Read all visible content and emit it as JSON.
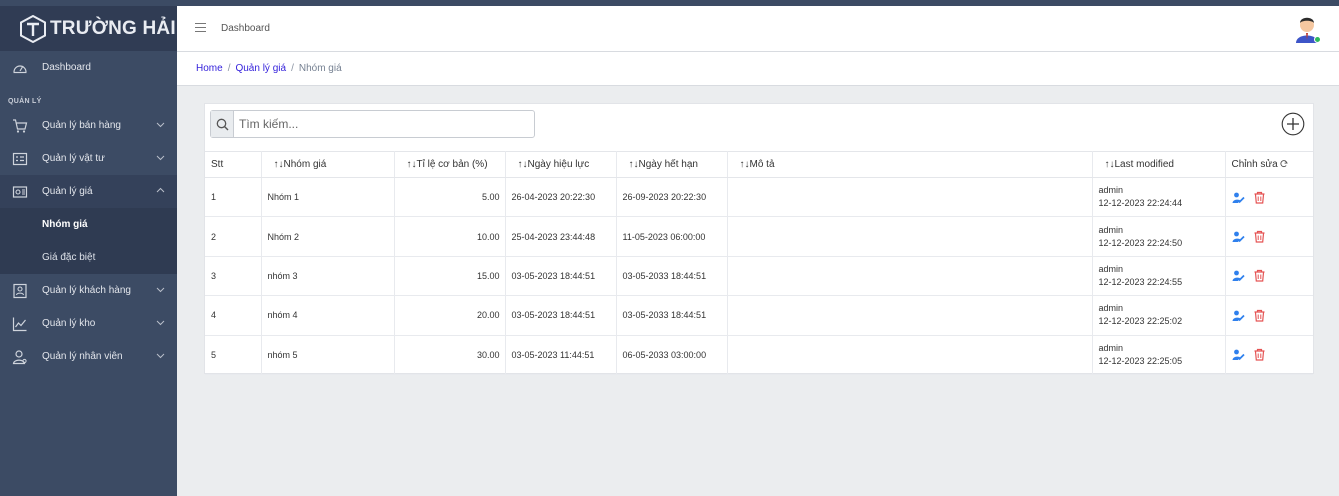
{
  "brand": {
    "name": "TRƯỜNG HẢI"
  },
  "sidebar": {
    "dashboard": "Dashboard",
    "section_title": "QUẢN LÝ",
    "items": [
      {
        "label": "Quản lý bán hàng",
        "icon": "cart-icon"
      },
      {
        "label": "Quản lý vật tư",
        "icon": "list-box-icon"
      },
      {
        "label": "Quản lý giá",
        "icon": "price-tag-icon",
        "expanded": true,
        "children": [
          {
            "label": "Nhóm giá",
            "selected": true
          },
          {
            "label": "Giá đặc biệt"
          }
        ]
      },
      {
        "label": "Quản lý khách hàng",
        "icon": "customer-icon"
      },
      {
        "label": "Quản lý kho",
        "icon": "chart-icon"
      },
      {
        "label": "Quản lý nhân viên",
        "icon": "staff-icon"
      }
    ]
  },
  "header": {
    "link": "Dashboard"
  },
  "breadcrumb": {
    "home": "Home",
    "level1": "Quản lý giá",
    "current": "Nhóm giá"
  },
  "search": {
    "placeholder": "Tìm kiếm...",
    "value": ""
  },
  "table": {
    "columns": [
      "Stt",
      "↑↓Nhóm giá",
      "↑↓Tỉ lệ cơ bản (%)",
      "↑↓Ngày hiệu lực",
      "↑↓Ngày hết hạn",
      "↑↓Mô tả",
      "↑↓Last modified",
      "Chỉnh sửa"
    ],
    "rows": [
      {
        "stt": "1",
        "nhom": "Nhóm 1",
        "tile": "5.00",
        "hieuluc": "26-04-2023 20:22:30",
        "hethan": "26-09-2023 20:22:30",
        "mota": "",
        "user": "admin",
        "modified": "12-12-2023 22:24:44"
      },
      {
        "stt": "2",
        "nhom": "Nhóm 2",
        "tile": "10.00",
        "hieuluc": "25-04-2023 23:44:48",
        "hethan": "11-05-2023 06:00:00",
        "mota": "",
        "user": "admin",
        "modified": "12-12-2023 22:24:50"
      },
      {
        "stt": "3",
        "nhom": "nhóm 3",
        "tile": "15.00",
        "hieuluc": "03-05-2023 18:44:51",
        "hethan": "03-05-2033 18:44:51",
        "mota": "",
        "user": "admin",
        "modified": "12-12-2023 22:24:55"
      },
      {
        "stt": "4",
        "nhom": "nhóm 4",
        "tile": "20.00",
        "hieuluc": "03-05-2023 18:44:51",
        "hethan": "03-05-2033 18:44:51",
        "mota": "",
        "user": "admin",
        "modified": "12-12-2023 22:25:02"
      },
      {
        "stt": "5",
        "nhom": "nhóm 5",
        "tile": "30.00",
        "hieuluc": "03-05-2023 11:44:51",
        "hethan": "06-05-2033 03:00:00",
        "mota": "",
        "user": "admin",
        "modified": "12-12-2023 22:25:05"
      }
    ]
  },
  "colors": {
    "sidebar": "#3c4b64",
    "link": "#321fdb",
    "edit": "#2f80ed",
    "delete": "#e55353",
    "online": "#2eb85c"
  }
}
